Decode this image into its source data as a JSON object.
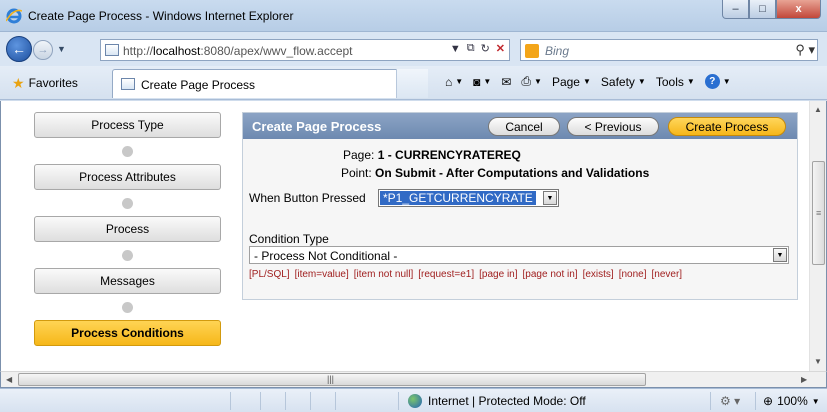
{
  "window": {
    "title": "Create Page Process - Windows Internet Explorer",
    "controls": {
      "minimize": "‒",
      "maximize": "□",
      "close": "x"
    }
  },
  "addressbar": {
    "url_prefix": "http://",
    "url_host": "localhost",
    "url_rest": ":8080/apex/wwv_flow.accept",
    "search_placeholder": "Bing"
  },
  "favorites_bar": {
    "favorites_label": "Favorites",
    "tab_label": "Create Page Process",
    "commands": [
      "Page",
      "Safety",
      "Tools"
    ]
  },
  "wizard": {
    "steps": [
      {
        "label": "Process Type",
        "active": false
      },
      {
        "label": "Process Attributes",
        "active": false
      },
      {
        "label": "Process",
        "active": false
      },
      {
        "label": "Messages",
        "active": false
      },
      {
        "label": "Process Conditions",
        "active": true
      }
    ]
  },
  "panel": {
    "title": "Create Page Process",
    "buttons": {
      "cancel": "Cancel",
      "previous": "< Previous",
      "create": "Create Process"
    },
    "page_label": "Page:",
    "page_value": "1 - CURRENCYRATEREQ",
    "point_label": "Point:",
    "point_value": "On Submit - After Computations and Validations",
    "when_button_label": "When Button Pressed",
    "when_button_value": "*P1_GETCURRENCYRATE",
    "condition_type_label": "Condition Type",
    "condition_type_value": "- Process Not Conditional -",
    "shortcuts": [
      "[PL/SQL]",
      "[item=value]",
      "[item not null]",
      "[request=e1]",
      "[page in]",
      "[page not in]",
      "[exists]",
      "[none]",
      "[never]"
    ]
  },
  "statusbar": {
    "zone": "Internet | Protected Mode: Off",
    "zoom": "100%"
  },
  "colors": {
    "panel_header": "#7a94b9",
    "active_step": "#f6b719",
    "shortcut_link": "#a02020"
  }
}
